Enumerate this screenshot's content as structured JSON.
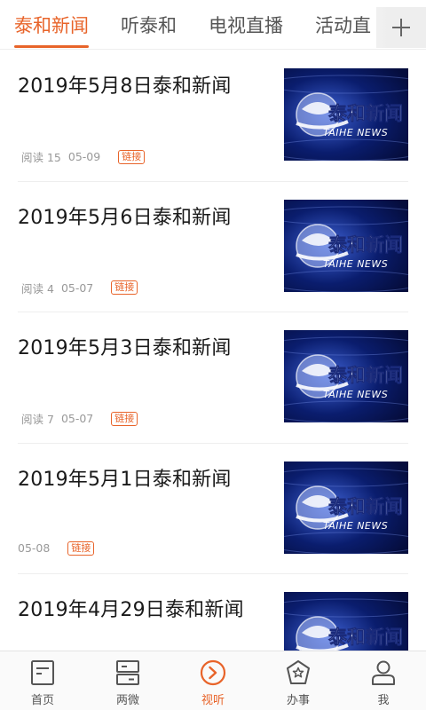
{
  "tabs": [
    {
      "label": "泰和新闻",
      "active": true
    },
    {
      "label": "听泰和",
      "active": false
    },
    {
      "label": "电视直播",
      "active": false
    },
    {
      "label": "活动直",
      "active": false
    }
  ],
  "add_icon": "plus-icon",
  "thumbnail_text": {
    "cn": "泰和新闻",
    "en": "TAIHE NEWS"
  },
  "articles": [
    {
      "title": "2019年5月8日泰和新闻",
      "reads": "阅读 15",
      "date": "05-09",
      "badge": "链接"
    },
    {
      "title": "2019年5月6日泰和新闻",
      "reads": "阅读 4",
      "date": "05-07",
      "badge": "链接"
    },
    {
      "title": "2019年5月3日泰和新闻",
      "reads": "阅读 7",
      "date": "05-07",
      "badge": "链接"
    },
    {
      "title": "2019年5月1日泰和新闻",
      "reads": "",
      "date": "05-08",
      "badge": "链接"
    },
    {
      "title": "2019年4月29日泰和新闻",
      "reads": "",
      "date": "",
      "badge": ""
    }
  ],
  "bottom_nav": [
    {
      "label": "首页",
      "icon": "home-doc-icon",
      "active": false
    },
    {
      "label": "两微",
      "icon": "two-panels-icon",
      "active": false
    },
    {
      "label": "视听",
      "icon": "play-circle-icon",
      "active": true
    },
    {
      "label": "办事",
      "icon": "star-badge-icon",
      "active": false
    },
    {
      "label": "我",
      "icon": "user-icon",
      "active": false
    }
  ],
  "colors": {
    "accent": "#e8642a",
    "text": "#1a1a1a",
    "muted": "#999999",
    "thumb_bg": "#0a1d6e"
  }
}
